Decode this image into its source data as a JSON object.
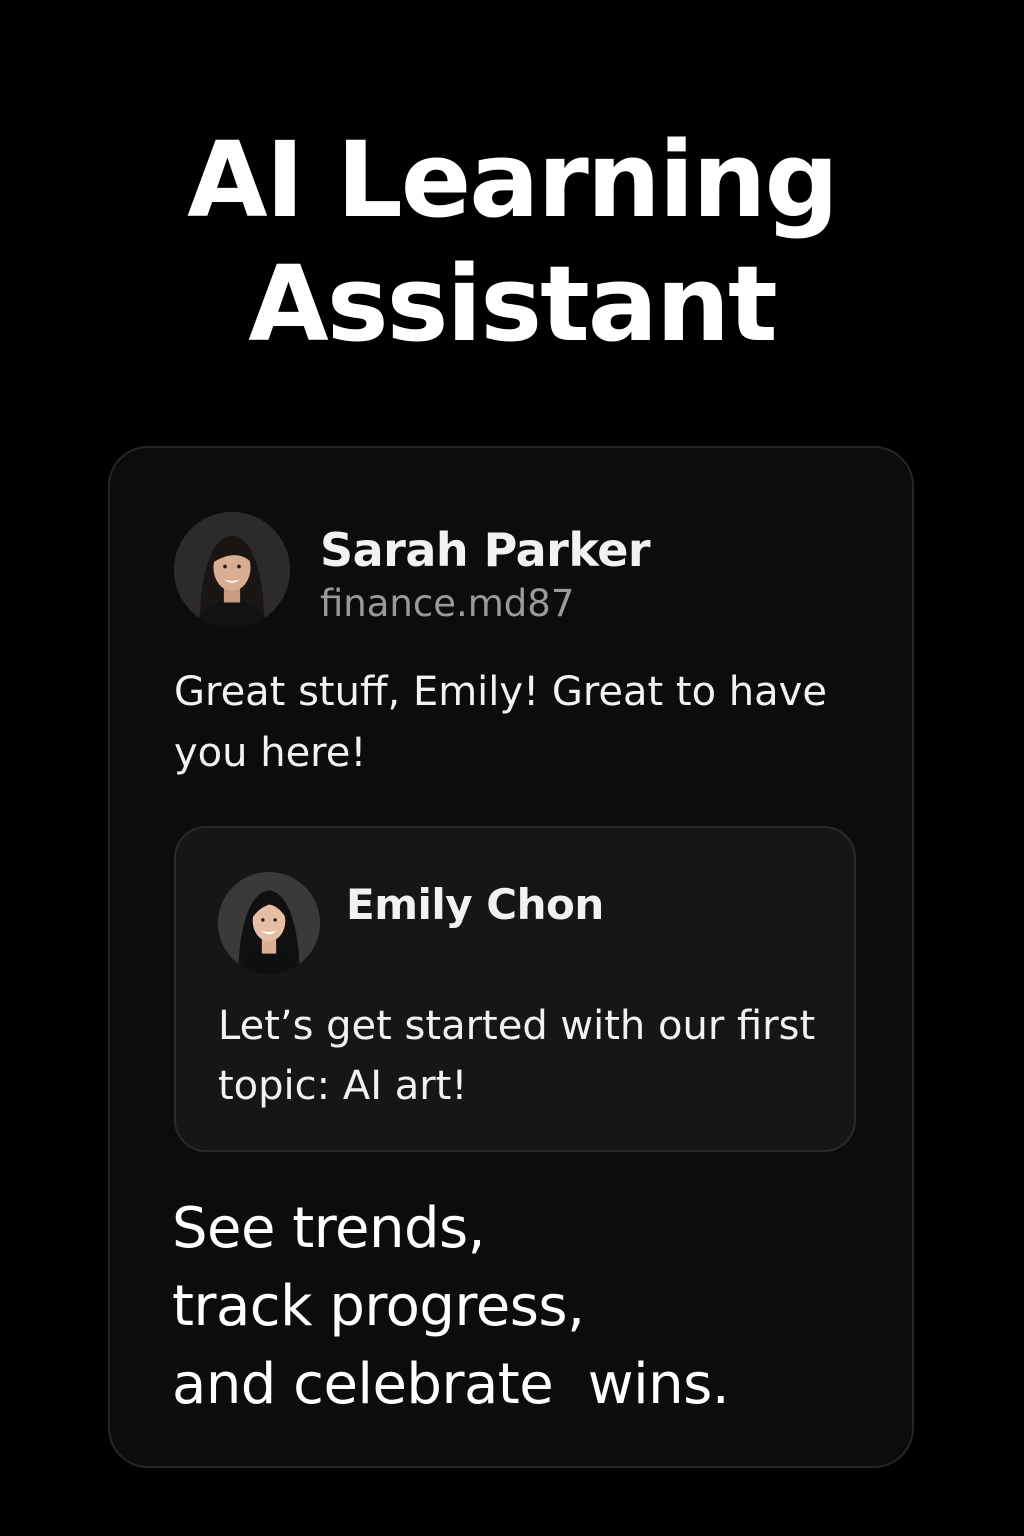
{
  "header": {
    "title_line1": "AI Learning",
    "title_line2": "Assistant"
  },
  "post": {
    "author": {
      "name": "Sarah Parker",
      "handle": "finance.md87",
      "avatar_icon": "woman-portrait-avatar"
    },
    "text": "Great stuff, Emily! Great to have you here!",
    "reply": {
      "author": {
        "name": "Emily Chon",
        "avatar_icon": "woman-portrait-avatar"
      },
      "text": "Let’s get started with our first topic: AI art!"
    }
  },
  "tagline": {
    "line1": "See trends,",
    "line2": "track progress,",
    "line3": "and celebrate  wins."
  },
  "colors": {
    "background": "#000000",
    "card_background": "#0c0c0d",
    "card_border": "#262626",
    "reply_background": "#161618",
    "text_primary": "#ffffff",
    "text_secondary": "#9a9a9c"
  }
}
